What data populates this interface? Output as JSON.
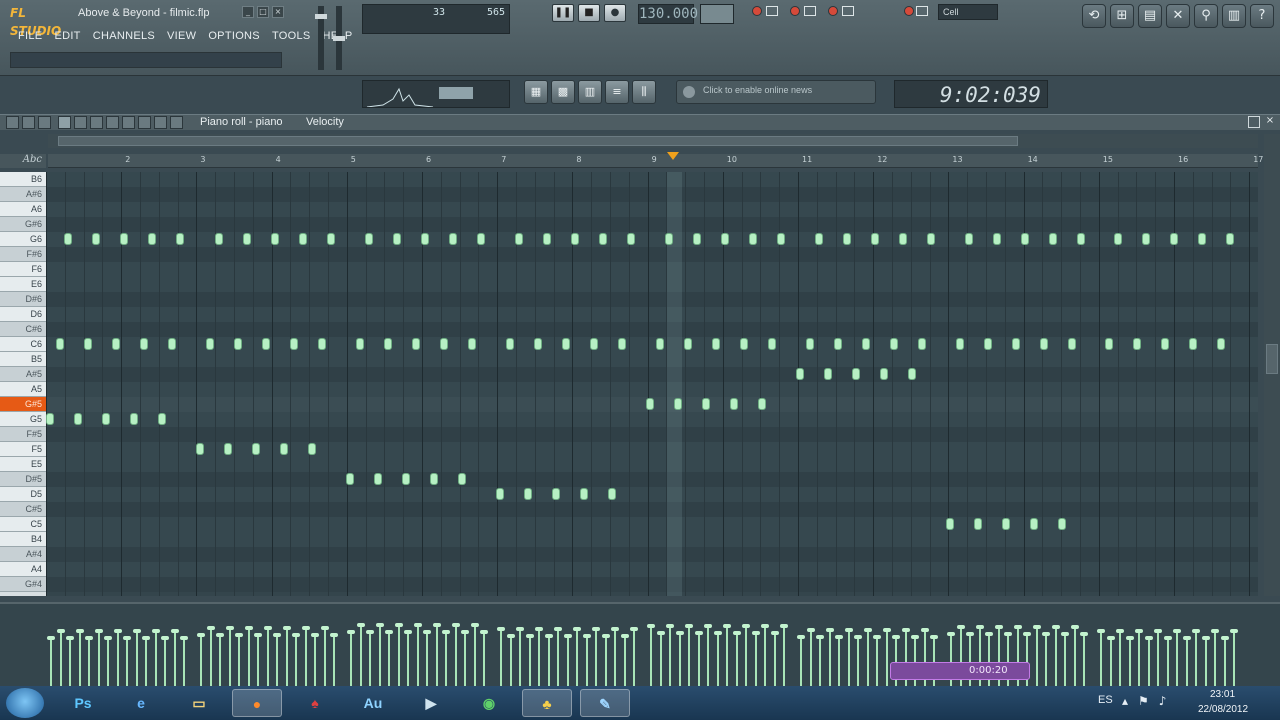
{
  "app": {
    "logo_text": "FL STUDIO",
    "window_title": "Above & Beyond - filmic.flp"
  },
  "menu": [
    "FILE",
    "EDIT",
    "CHANNELS",
    "VIEW",
    "OPTIONS",
    "TOOLS",
    "HELP"
  ],
  "monitor": {
    "cpu": "33",
    "poly": "565"
  },
  "transport": {
    "tempo": "130.000",
    "pause_icon": "pause-icon",
    "stop_icon": "stop-icon",
    "record_icon": "record-icon"
  },
  "snap": {
    "value": "Cell"
  },
  "news": {
    "text": "Click to enable online news"
  },
  "time_display": "9:02:039",
  "piano_roll": {
    "title": "Piano roll - piano",
    "target": "Velocity",
    "abc_label": "Abc",
    "ruler": [
      "2",
      "3",
      "4",
      "5",
      "6",
      "7",
      "8",
      "9",
      "10",
      "11",
      "12",
      "13",
      "14",
      "15",
      "16",
      "17"
    ],
    "keys": [
      "B6",
      "A#6",
      "A6",
      "G#6",
      "G6",
      "F#6",
      "F6",
      "E6",
      "D#6",
      "D6",
      "C#6",
      "C6",
      "B5",
      "A#5",
      "A5",
      "G#5",
      "G5",
      "F#5",
      "F5",
      "E5",
      "D#5",
      "D5",
      "C#5",
      "C5",
      "B4",
      "A#4",
      "A4",
      "G#4"
    ],
    "highlighted_key": "G#5"
  },
  "recorder": {
    "time": "0:00:20"
  },
  "taskbar": {
    "apps": [
      "Ps",
      "IE",
      "Folder",
      "Firefox",
      "FL",
      "Au",
      "Media",
      "Chrome",
      "FL Studio",
      "Paint"
    ],
    "language": "ES",
    "time": "23:01",
    "date": "22/08/2012"
  }
}
